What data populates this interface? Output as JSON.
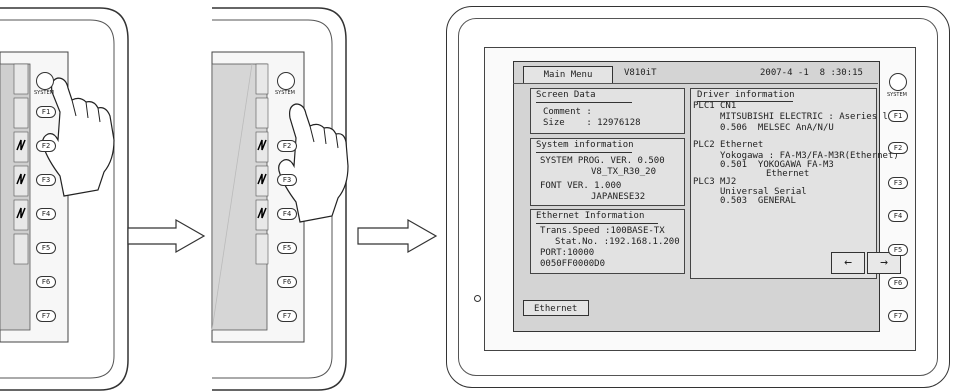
{
  "side_panel": {
    "system_label": "SYSTEM",
    "function_keys": [
      "F1",
      "F2",
      "F3",
      "F4",
      "F5",
      "F6",
      "F7"
    ]
  },
  "hmi_screen": {
    "header": {
      "main_menu_button": "Main Menu",
      "model": "V810iT",
      "datetime": "2007-4 -1  8 :30:15"
    },
    "screen_data": {
      "title": "Screen Data",
      "lines": [
        "Comment :",
        "Size    : 12976128"
      ]
    },
    "system_information": {
      "title": "System information",
      "lines": [
        "SYSTEM PROG. VER. 0.500",
        "V8_TX_R30_20",
        "FONT VER. 1.000",
        "JAPANESE32"
      ]
    },
    "ethernet_information": {
      "title": "Ethernet Information",
      "lines": [
        "Trans.Speed :100BASE-TX",
        "Stat.No. :192.168.1.200",
        "PORT:10000",
        "0050FF0000D0"
      ]
    },
    "driver_information": {
      "title": "Driver information",
      "plc1": [
        "PLC1",
        "CN1",
        "MITSUBISHI ELECTRIC : Aseries link",
        "0.506  MELSEC AnA/N/U"
      ],
      "plc2": [
        "PLC2",
        "Ethernet",
        "Yokogawa : FA-M3/FA-M3R(Ethernet)",
        "0.501  YOKOGAWA FA-M3",
        "Ethernet"
      ],
      "plc3": [
        "PLC3",
        "MJ2",
        "Universal Serial",
        "0.503  GENERAL"
      ],
      "prev_arrow": "←",
      "next_arrow": "→"
    },
    "ethernet_button": "Ethernet"
  },
  "colors": {
    "screen_bg": "#d4d4d4",
    "panel_bg": "#e6e6e6",
    "outline": "#333333"
  },
  "icons": [
    "hand-pointer-icon",
    "right-arrow-icon"
  ]
}
